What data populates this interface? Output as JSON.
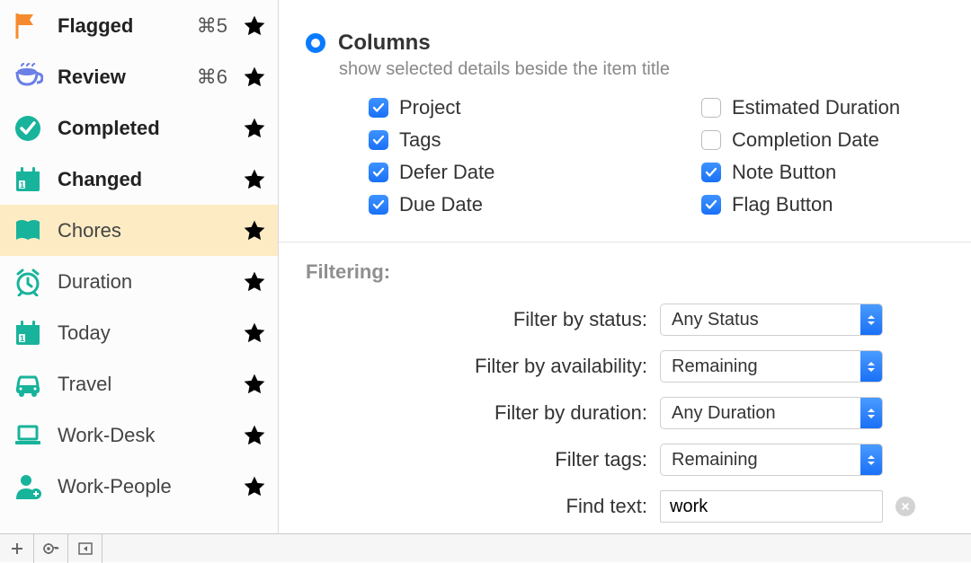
{
  "sidebar": {
    "items": [
      {
        "icon": "flag",
        "label": "Flagged",
        "bold": true,
        "shortcut": "⌘5",
        "favorite": true,
        "selected": false
      },
      {
        "icon": "cup",
        "label": "Review",
        "bold": true,
        "shortcut": "⌘6",
        "favorite": true,
        "selected": false
      },
      {
        "icon": "check",
        "label": "Completed",
        "bold": true,
        "shortcut": "",
        "favorite": false,
        "selected": false
      },
      {
        "icon": "calendar",
        "label": "Changed",
        "bold": true,
        "shortcut": "",
        "favorite": false,
        "selected": false
      },
      {
        "icon": "book",
        "label": "Chores",
        "bold": false,
        "shortcut": "",
        "favorite": true,
        "selected": true
      },
      {
        "icon": "alarm",
        "label": "Duration",
        "bold": false,
        "shortcut": "",
        "favorite": false,
        "selected": false
      },
      {
        "icon": "calendar",
        "label": "Today",
        "bold": false,
        "shortcut": "",
        "favorite": true,
        "selected": false
      },
      {
        "icon": "car",
        "label": "Travel",
        "bold": false,
        "shortcut": "",
        "favorite": false,
        "selected": false
      },
      {
        "icon": "laptop",
        "label": "Work-Desk",
        "bold": false,
        "shortcut": "",
        "favorite": false,
        "selected": false
      },
      {
        "icon": "person",
        "label": "Work-People",
        "bold": false,
        "shortcut": "",
        "favorite": false,
        "selected": false
      }
    ]
  },
  "main": {
    "columns": {
      "title": "Columns",
      "subtitle": "show selected details beside the item title",
      "left": [
        {
          "label": "Project",
          "checked": true
        },
        {
          "label": "Tags",
          "checked": true
        },
        {
          "label": "Defer Date",
          "checked": true
        },
        {
          "label": "Due Date",
          "checked": true
        }
      ],
      "right": [
        {
          "label": "Estimated Duration",
          "checked": false
        },
        {
          "label": "Completion Date",
          "checked": false
        },
        {
          "label": "Note Button",
          "checked": true
        },
        {
          "label": "Flag Button",
          "checked": true
        }
      ]
    },
    "filtering": {
      "title": "Filtering:",
      "rows": {
        "status": {
          "label": "Filter by status:",
          "value": "Any Status"
        },
        "availability": {
          "label": "Filter by availability:",
          "value": "Remaining"
        },
        "duration": {
          "label": "Filter by duration:",
          "value": "Any Duration"
        },
        "tags": {
          "label": "Filter tags:",
          "value": "Remaining"
        },
        "find": {
          "label": "Find text:",
          "value": "work"
        }
      }
    }
  },
  "icons": {
    "flag_color": "#f58b2e",
    "cup_color": "#6b7fe6",
    "check_color": "#18b39b",
    "calendar_color": "#18b39b",
    "book_color": "#18b39b",
    "alarm_color": "#18b39b",
    "car_color": "#18b39b",
    "laptop_color": "#18b39b",
    "person_color": "#18b39b",
    "star_filled": "#f5a623"
  }
}
